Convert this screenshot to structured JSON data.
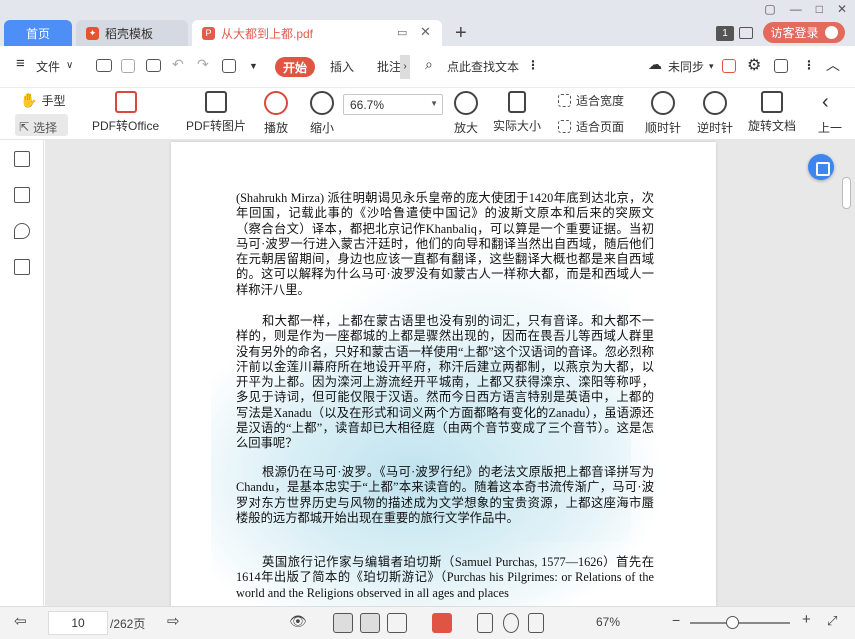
{
  "tabs": {
    "home": "首页",
    "template": "稻壳模板",
    "document": "从大都到上都.pdf"
  },
  "topright": {
    "badge": "1",
    "login": "访客登录"
  },
  "menu": {
    "file": "文件",
    "start": "开始",
    "insert": "插入",
    "annotate": "批注",
    "search": "点此查找文本",
    "sync": "未同步"
  },
  "ribbon": {
    "hand": "手型",
    "select": "选择",
    "pdf_to_office": "PDF转Office",
    "pdf_to_image": "PDF转图片",
    "play": "播放",
    "zoom_out": "缩小",
    "zoom_value": "66.7%",
    "zoom_in": "放大",
    "actual_size": "实际大小",
    "fit_width": "适合宽度",
    "fit_page": "适合页面",
    "rotate_cw": "顺时针",
    "rotate_ccw": "逆时针",
    "rotate_doc": "旋转文档",
    "prev": "上一"
  },
  "document": {
    "p1": "(Shahrukh Mirza) 派往明朝谒见永乐皇帝的庞大使团于1420年底到达北京，次年回国，记载此事的《沙哈鲁遣使中国记》的波斯文原本和后来的突厥文（察合台文）译本，都把北京记作Khanbaliq，可以算是一个重要证据。当初马可·波罗一行进入蒙古汗廷时，他们的向导和翻译当然出自西域，随后他们在元朝居留期间，身边也应该一直都有翻译，这些翻译大概也都是来自西域的。这可以解释为什么马可·波罗没有如蒙古人一样称大都，而是和西域人一样称汗八里。",
    "p2": "和大都一样，上都在蒙古语里也没有别的词汇，只有音译。和大都不一样的，则是作为一座都城的上都是骤然出现的，因而在畏吾儿等西域人群里没有另外的命名，只好和蒙古语一样使用“上都”这个汉语词的音译。忽必烈称汗前以金莲川幕府所在地设开平府，称汗后建立两都制，以燕京为大都，以开平为上都。因为滦河上游流经开平城南，上都又获得滦京、滦阳等称呼，多见于诗词，但可能仅限于汉语。然而今日西方语言特别是英语中，上都的写法是Xanadu（以及在形式和词义两个方面都略有变化的Zanadu），虽语源还是汉语的“上都”，读音却已大相径庭（由两个音节变成了三个音节）。这是怎么回事呢？",
    "p3": "根源仍在马可·波罗。《马可·波罗行纪》的老法文原版把上都音译拼写为Chandu，是基本忠实于“上都”本来读音的。随着这本奇书流传渐广，马可·波罗对东方世界历史与风物的描述成为文学想象的宝贵资源，上都这座海市蜃楼般的远方都城开始出现在重要的旅行文学作品中。",
    "p4": "英国旅行记作家与编辑者珀切斯（Samuel Purchas, 1577—1626）首先在1614年出版了简本的《珀切斯游记》（Purchas his Pilgrimes: or Relations of the world and the Religions observed in all ages and places"
  },
  "status": {
    "page": "10",
    "total": "/262页",
    "zoom": "67%"
  }
}
